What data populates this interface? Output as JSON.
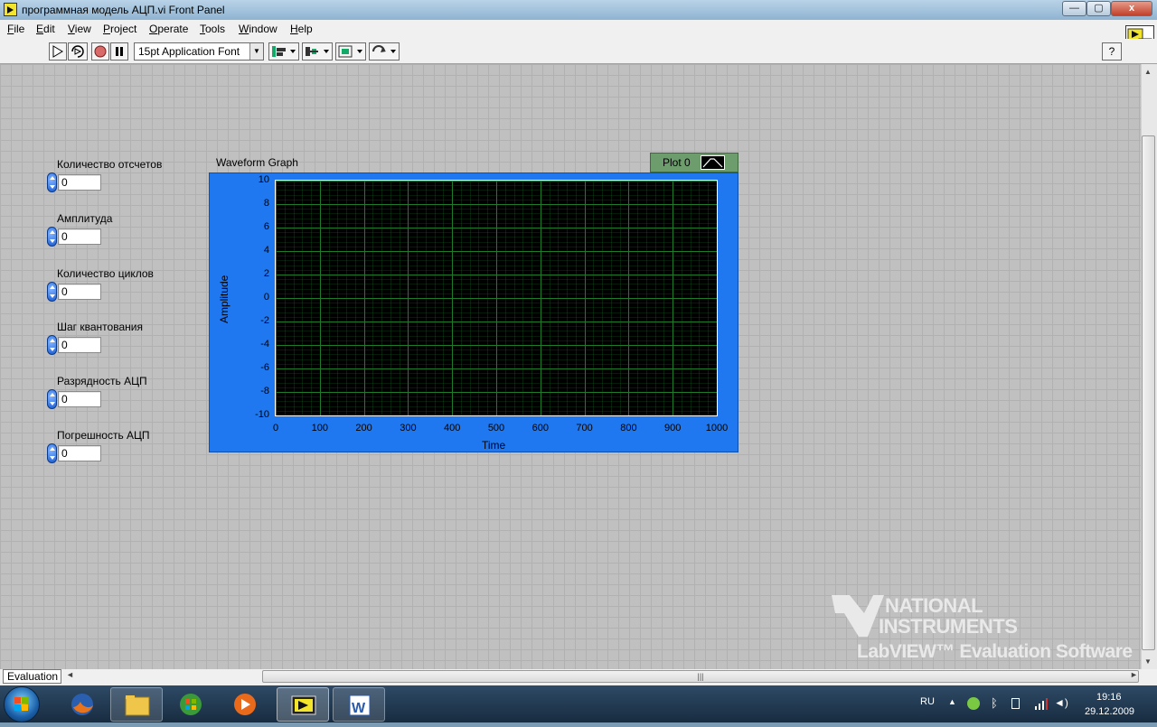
{
  "window": {
    "title": "программная модель АЦП.vi Front Panel",
    "buttons": {
      "minimize": "—",
      "maximize": "▢",
      "close": "x"
    }
  },
  "menu": [
    "File",
    "Edit",
    "View",
    "Project",
    "Operate",
    "Tools",
    "Window",
    "Help"
  ],
  "toolbar": {
    "font": "15pt Application Font",
    "run_icon": "run-arrow-icon",
    "run_continuous_icon": "run-continuously-icon",
    "abort_icon": "abort-icon",
    "pause_icon": "pause-icon",
    "help_label": "?"
  },
  "controls": [
    {
      "label": "Количество отсчетов",
      "value": "0"
    },
    {
      "label": "Амплитуда",
      "value": "0"
    },
    {
      "label": "Количество циклов",
      "value": "0"
    },
    {
      "label": "Шаг квантования",
      "value": "0"
    },
    {
      "label": "Разрядность АЦП",
      "value": "0"
    },
    {
      "label": "Погрешность АЦП",
      "value": "0"
    }
  ],
  "graph": {
    "title": "Waveform Graph",
    "legend": "Plot 0",
    "xlabel": "Time",
    "ylabel": "Amplitude",
    "xticks": [
      "0",
      "100",
      "200",
      "300",
      "400",
      "500",
      "600",
      "700",
      "800",
      "900",
      "1000"
    ],
    "yticks": [
      "10",
      "8",
      "6",
      "4",
      "2",
      "0",
      "-2",
      "-4",
      "-6",
      "-8",
      "-10"
    ],
    "plot_bg": "#000000",
    "grid_color": "#1f7a2a",
    "frame_color": "#1f78f0"
  },
  "watermark": {
    "line1": "NATIONAL",
    "line2": "INSTRUMENTS",
    "line3": "LabVIEW™ Evaluation Software"
  },
  "status": {
    "context": "Evaluation"
  },
  "taskbar": {
    "apps": [
      "firefox-icon",
      "explorer-icon",
      "media-center-icon",
      "media-player-icon",
      "labview-icon",
      "word-icon"
    ],
    "lang": "RU",
    "time": "19:16",
    "date": "29.12.2009"
  }
}
